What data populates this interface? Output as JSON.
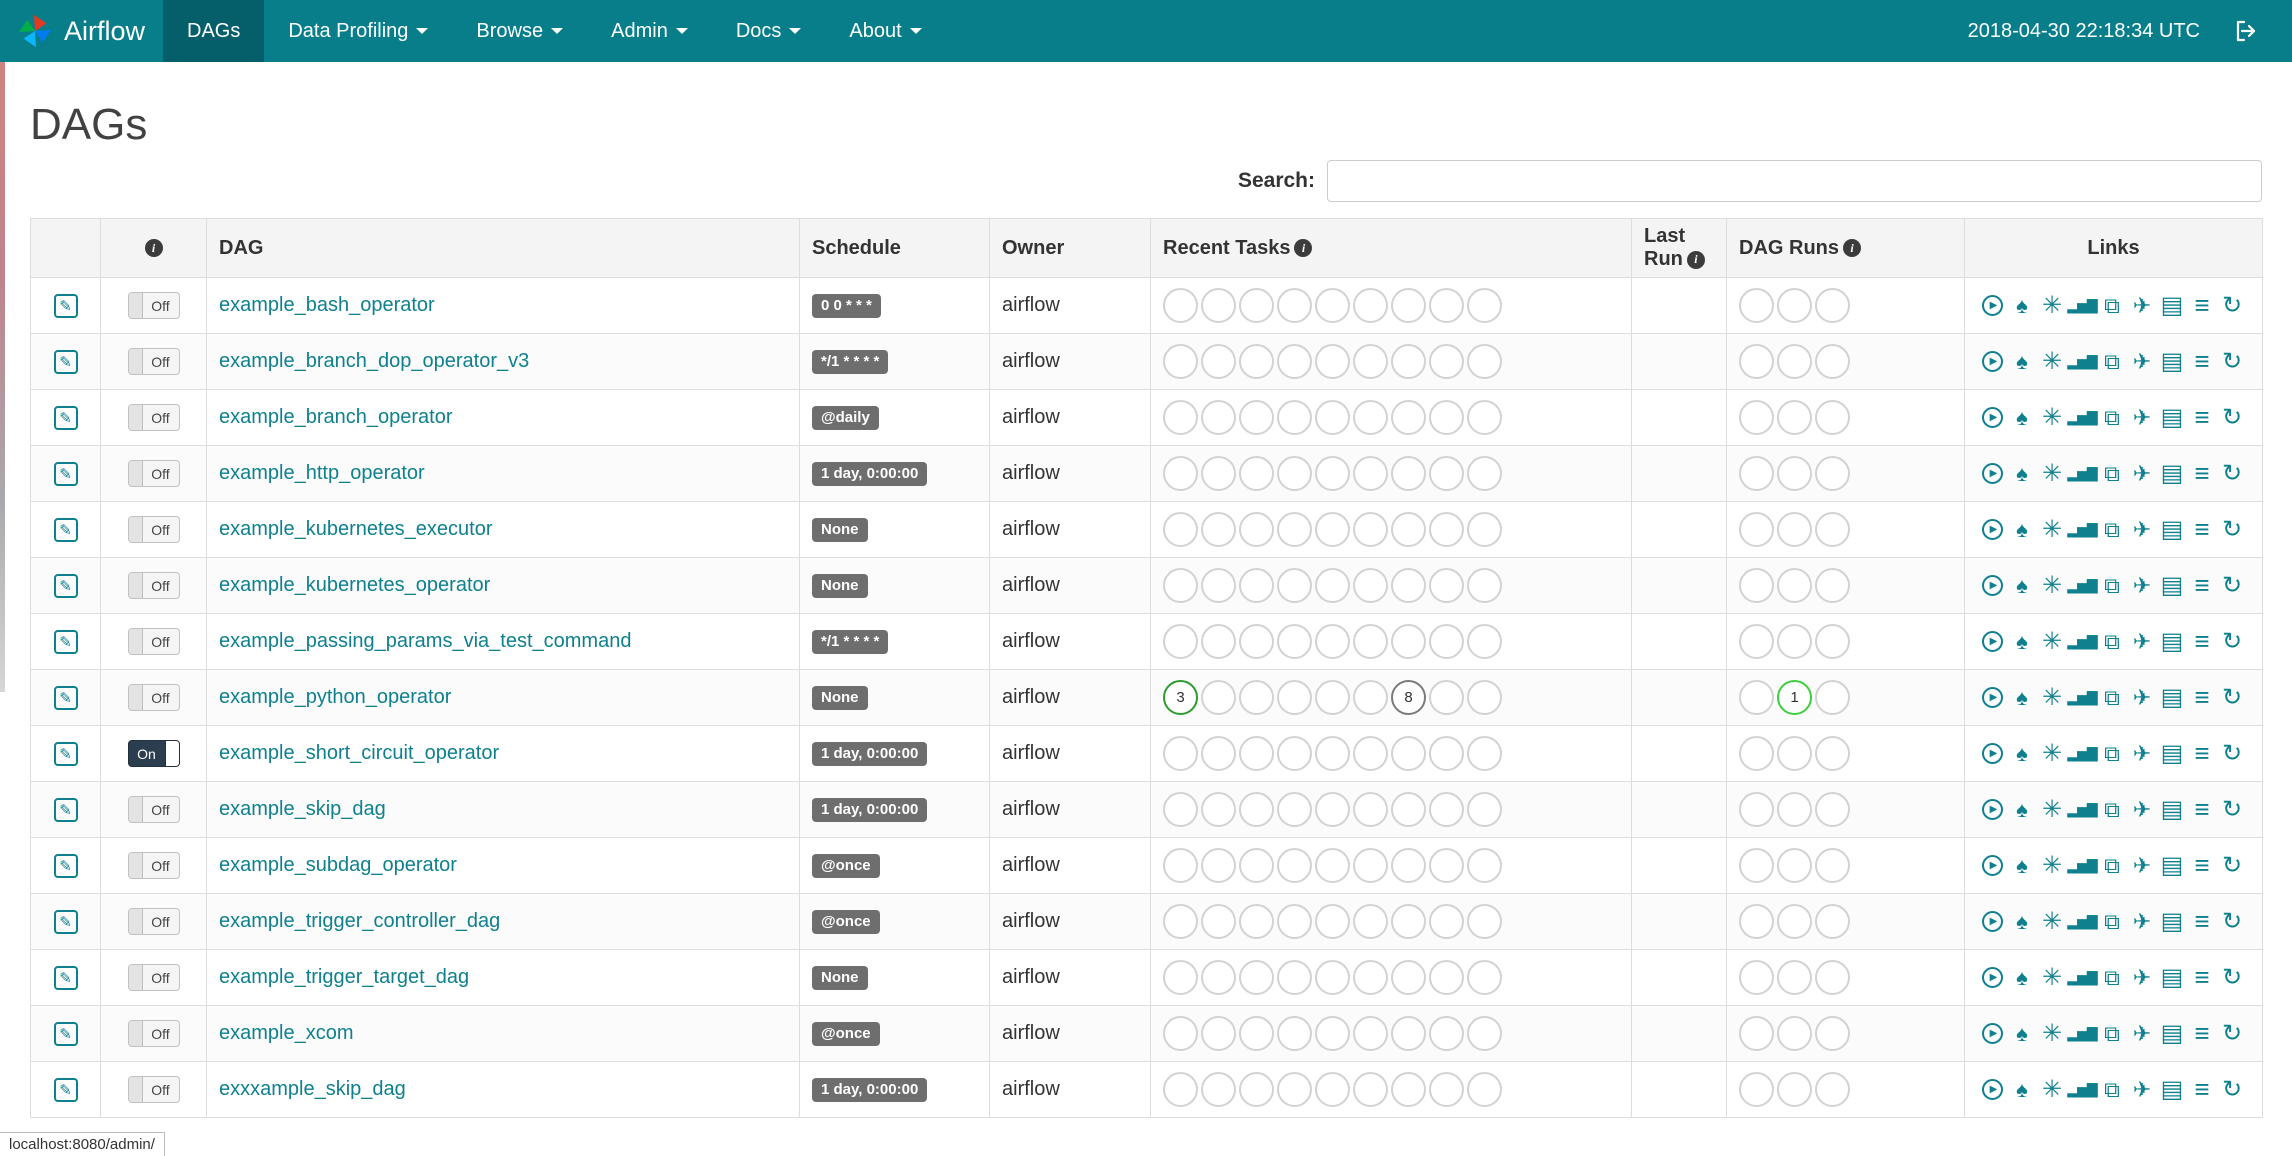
{
  "icons": {
    "info": "i",
    "edit": "✎"
  },
  "navbar": {
    "brand": "Airflow",
    "items": [
      {
        "label": "DAGs",
        "active": true
      },
      {
        "label": "Data Profiling",
        "active": false
      },
      {
        "label": "Browse",
        "active": false
      },
      {
        "label": "Admin",
        "active": false
      },
      {
        "label": "Docs",
        "active": false
      },
      {
        "label": "About",
        "active": false
      }
    ],
    "clock": "2018-04-30 22:18:34 UTC"
  },
  "page": {
    "title": "DAGs"
  },
  "search": {
    "label": "Search:",
    "value": ""
  },
  "table": {
    "headers": {
      "dag": "DAG",
      "schedule": "Schedule",
      "owner": "Owner",
      "recent_tasks": "Recent Tasks",
      "last_run": "Last Run",
      "dag_runs": "DAG Runs",
      "links": "Links"
    },
    "recent_task_slots": 9,
    "dag_run_slots": 3,
    "link_icons": [
      {
        "name": "trigger-dag-icon",
        "glyph": "▶"
      },
      {
        "name": "tree-view-icon",
        "glyph": "♠"
      },
      {
        "name": "graph-view-icon",
        "glyph": "✳"
      },
      {
        "name": "task-duration-icon",
        "glyph": "▂▅▇"
      },
      {
        "name": "task-tries-icon",
        "glyph": "⧉"
      },
      {
        "name": "landing-times-icon",
        "glyph": "✈"
      },
      {
        "name": "gantt-icon",
        "glyph": "▤"
      },
      {
        "name": "code-icon",
        "glyph": "≡"
      },
      {
        "name": "refresh-icon",
        "glyph": "↻"
      }
    ],
    "rows": [
      {
        "dag": "example_bash_operator",
        "toggle": "Off",
        "paused": true,
        "schedule": "0 0 * * *",
        "owner": "airflow"
      },
      {
        "dag": "example_branch_dop_operator_v3",
        "toggle": "Off",
        "paused": true,
        "schedule": "*/1 * * * *",
        "owner": "airflow"
      },
      {
        "dag": "example_branch_operator",
        "toggle": "Off",
        "paused": true,
        "schedule": "@daily",
        "owner": "airflow"
      },
      {
        "dag": "example_http_operator",
        "toggle": "Off",
        "paused": true,
        "schedule": "1 day, 0:00:00",
        "owner": "airflow"
      },
      {
        "dag": "example_kubernetes_executor",
        "toggle": "Off",
        "paused": true,
        "schedule": "None",
        "owner": "airflow"
      },
      {
        "dag": "example_kubernetes_operator",
        "toggle": "Off",
        "paused": true,
        "schedule": "None",
        "owner": "airflow"
      },
      {
        "dag": "example_passing_params_via_test_command",
        "toggle": "Off",
        "paused": true,
        "schedule": "*/1 * * * *",
        "owner": "airflow"
      },
      {
        "dag": "example_python_operator",
        "toggle": "Off",
        "paused": true,
        "schedule": "None",
        "owner": "airflow",
        "recent_tasks_counts": [
          {
            "slot": 0,
            "value": "3",
            "state": "success",
            "color": "#2d9a2d"
          },
          {
            "slot": 6,
            "value": "8",
            "state": "queued",
            "color": "#7a7a7a"
          }
        ],
        "dag_runs_counts": [
          {
            "slot": 1,
            "value": "1",
            "state": "running",
            "color": "#3fce3f"
          }
        ]
      },
      {
        "dag": "example_short_circuit_operator",
        "toggle": "On",
        "paused": false,
        "schedule": "1 day, 0:00:00",
        "owner": "airflow"
      },
      {
        "dag": "example_skip_dag",
        "toggle": "Off",
        "paused": true,
        "schedule": "1 day, 0:00:00",
        "owner": "airflow"
      },
      {
        "dag": "example_subdag_operator",
        "toggle": "Off",
        "paused": true,
        "schedule": "@once",
        "owner": "airflow"
      },
      {
        "dag": "example_trigger_controller_dag",
        "toggle": "Off",
        "paused": true,
        "schedule": "@once",
        "owner": "airflow"
      },
      {
        "dag": "example_trigger_target_dag",
        "toggle": "Off",
        "paused": true,
        "schedule": "None",
        "owner": "airflow"
      },
      {
        "dag": "example_xcom",
        "toggle": "Off",
        "paused": true,
        "schedule": "@once",
        "owner": "airflow"
      },
      {
        "dag": "exxxample_skip_dag",
        "toggle": "Off",
        "paused": true,
        "schedule": "1 day, 0:00:00",
        "owner": "airflow"
      }
    ]
  },
  "statusbar": {
    "text": "localhost:8080/admin/"
  }
}
